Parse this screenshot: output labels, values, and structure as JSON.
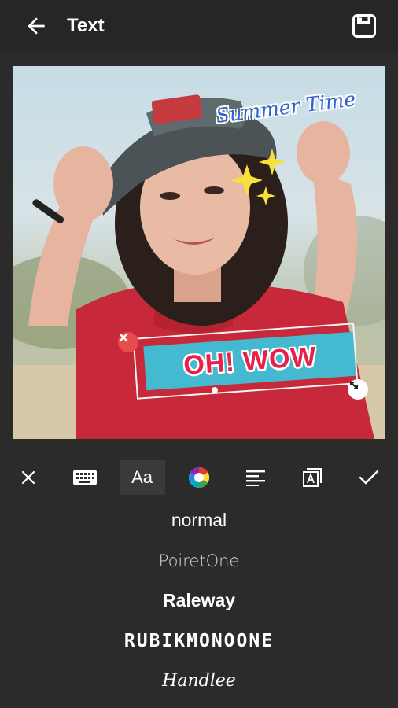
{
  "header": {
    "title": "Text",
    "back_icon": "arrow-left-icon",
    "save_icon": "save-icon"
  },
  "canvas": {
    "stickers": {
      "summer_text": "Summer Time",
      "main_text": "OH! WOW"
    },
    "colors": {
      "main_text": "#e8214b",
      "main_bg": "#45b9cf",
      "summer_text": "#2f63d0",
      "delete_handle": "#e84b4b"
    }
  },
  "toolbar": {
    "items": [
      {
        "name": "close",
        "icon": "close-icon"
      },
      {
        "name": "keyboard",
        "icon": "keyboard-icon"
      },
      {
        "name": "font",
        "label": "Aa"
      },
      {
        "name": "color",
        "icon": "color-wheel-icon"
      },
      {
        "name": "align",
        "icon": "align-left-icon"
      },
      {
        "name": "text-style",
        "icon": "text-box-icon"
      },
      {
        "name": "confirm",
        "icon": "check-icon"
      }
    ],
    "active": "font"
  },
  "fonts": {
    "items": [
      {
        "label": "normal"
      },
      {
        "label": "PoiretOne"
      },
      {
        "label": "Raleway"
      },
      {
        "label": "RUBIKMONOONE"
      },
      {
        "label": "Handlee"
      }
    ]
  }
}
